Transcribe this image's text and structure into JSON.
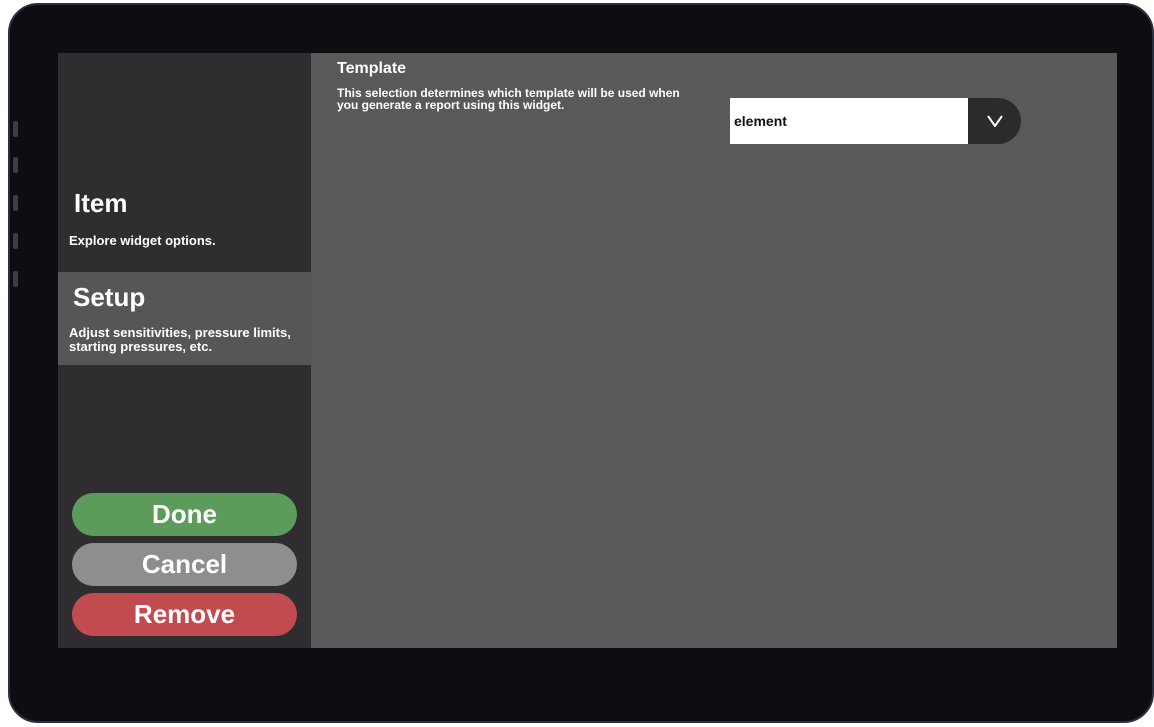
{
  "panel": {
    "title": "Template",
    "description": "This selection determines which template will be used when you generate a report using this widget.",
    "select": {
      "value": "element",
      "toggle_icon": "chevron-down-icon"
    }
  },
  "sidebar": {
    "items": [
      {
        "title": "Item",
        "description": "Explore widget options.",
        "selected": false
      },
      {
        "title": "Setup",
        "description": "Adjust sensitivities, pressure limits, starting pressures, etc.",
        "selected": true
      }
    ],
    "actions": {
      "done_label": "Done",
      "cancel_label": "Cancel",
      "remove_label": "Remove"
    }
  },
  "colors": {
    "screen_bg": "#595959",
    "sidebar_bg": "#2f2d30",
    "selected_bg": "#565656",
    "done": "#5c9c5a",
    "cancel": "#8e8e8e",
    "remove": "#c24b4f"
  }
}
